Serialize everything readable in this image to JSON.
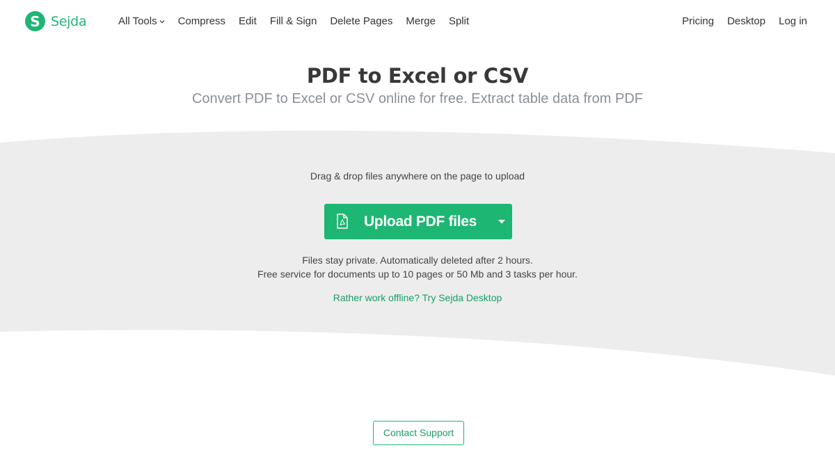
{
  "header": {
    "logo_mark": "S",
    "logo_text": "Sejda",
    "nav": [
      {
        "label": "All Tools"
      },
      {
        "label": "Compress"
      },
      {
        "label": "Edit"
      },
      {
        "label": "Fill & Sign"
      },
      {
        "label": "Delete Pages"
      },
      {
        "label": "Merge"
      },
      {
        "label": "Split"
      }
    ],
    "nav_right": [
      {
        "label": "Pricing"
      },
      {
        "label": "Desktop"
      },
      {
        "label": "Log in"
      }
    ]
  },
  "hero": {
    "title": "PDF to Excel or CSV",
    "subtitle": "Convert PDF to Excel or CSV online for free. Extract table data from PDF"
  },
  "upload": {
    "drag_hint": "Drag & drop files anywhere on the page to upload",
    "button_label": "Upload PDF files",
    "button_icon": "pdf-file-icon",
    "caret_icon": "caret-down-icon",
    "note_line_1": "Files stay private. Automatically deleted after 2 hours.",
    "note_line_2": "Free service for documents up to 10 pages or 50 Mb and 3 tasks per hour.",
    "offline_link": "Rather work offline? Try Sejda Desktop"
  },
  "footer": {
    "contact_label": "Contact Support"
  },
  "colors": {
    "brand_green": "#1eb673",
    "link_green": "#1a9e63",
    "panel_gray": "#ededed",
    "subtitle_gray": "#8a8f99"
  }
}
